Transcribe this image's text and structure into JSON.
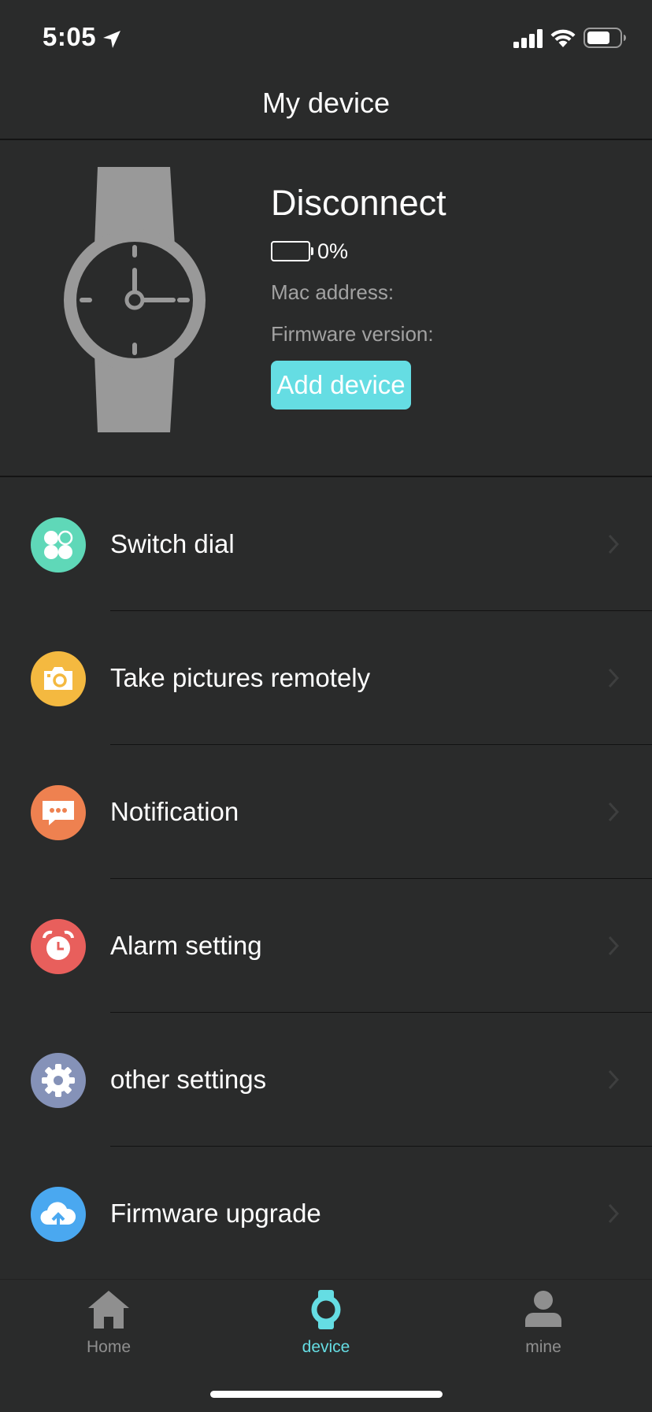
{
  "status_bar": {
    "time": "5:05"
  },
  "nav": {
    "title": "My device"
  },
  "device": {
    "status": "Disconnect",
    "battery_percent": "0%",
    "mac_label": "Mac address:",
    "firmware_label": "Firmware version:",
    "add_button": "Add device"
  },
  "menu": {
    "items": [
      {
        "label": "Switch dial",
        "icon": "dial-icon",
        "color": "#5fd8b8"
      },
      {
        "label": "Take pictures remotely",
        "icon": "camera-icon",
        "color": "#f4b940"
      },
      {
        "label": "Notification",
        "icon": "message-icon",
        "color": "#ee8150"
      },
      {
        "label": "Alarm setting",
        "icon": "alarm-clock-icon",
        "color": "#e85f5c"
      },
      {
        "label": "other settings",
        "icon": "gear-icon",
        "color": "#8592b8"
      },
      {
        "label": "Firmware upgrade",
        "icon": "cloud-upload-icon",
        "color": "#4aa8f0"
      }
    ]
  },
  "tabs": [
    {
      "label": "Home",
      "icon": "home-icon",
      "active": false
    },
    {
      "label": "device",
      "icon": "watch-icon",
      "active": true
    },
    {
      "label": "mine",
      "icon": "person-icon",
      "active": false
    }
  ],
  "colors": {
    "accent": "#65dde3",
    "background": "#2a2b2b",
    "muted_text": "#a2a2a2"
  }
}
